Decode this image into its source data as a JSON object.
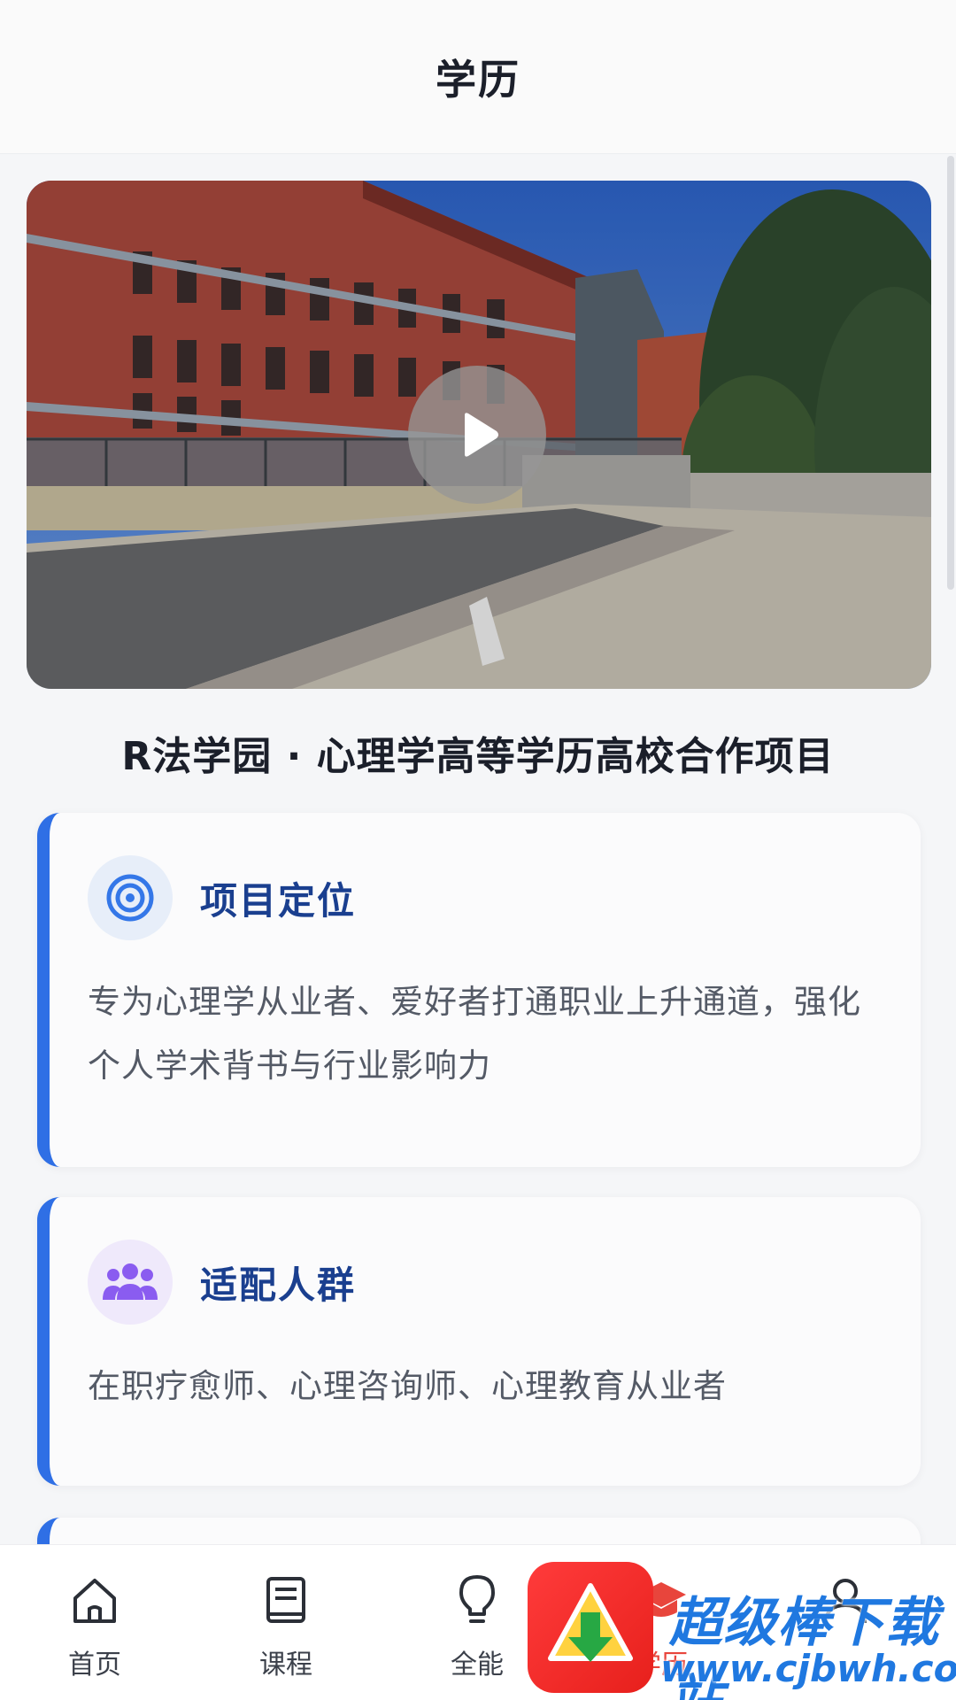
{
  "header": {
    "title": "学历"
  },
  "hero": {
    "play_icon": "play-icon"
  },
  "headline": "R法学园 · 心理学高等学历高校合作项目",
  "cards": [
    {
      "icon": "target-icon",
      "title": "项目定位",
      "body": "专为心理学从业者、爱好者打通职业上升通道，强化个人学术背书与行业影响力"
    },
    {
      "icon": "users-icon",
      "title": "适配人群",
      "body": "在职疗愈师、心理咨询师、心理教育从业者"
    }
  ],
  "nav": {
    "items": [
      {
        "label": "首页",
        "icon": "home-icon"
      },
      {
        "label": "课程",
        "icon": "book-icon"
      },
      {
        "label": "全能",
        "icon": "lightbulb-icon"
      },
      {
        "label": "学历",
        "icon": "graduation-cap-icon",
        "active": true
      },
      {
        "label": "",
        "icon": "user-icon"
      }
    ],
    "active_color": "#e8453c"
  },
  "watermark": {
    "title": "超级棒下载站",
    "url": "www.cjbwh.com"
  },
  "colors": {
    "accent": "#2f6fe5",
    "card_title": "#1a3f8f"
  }
}
